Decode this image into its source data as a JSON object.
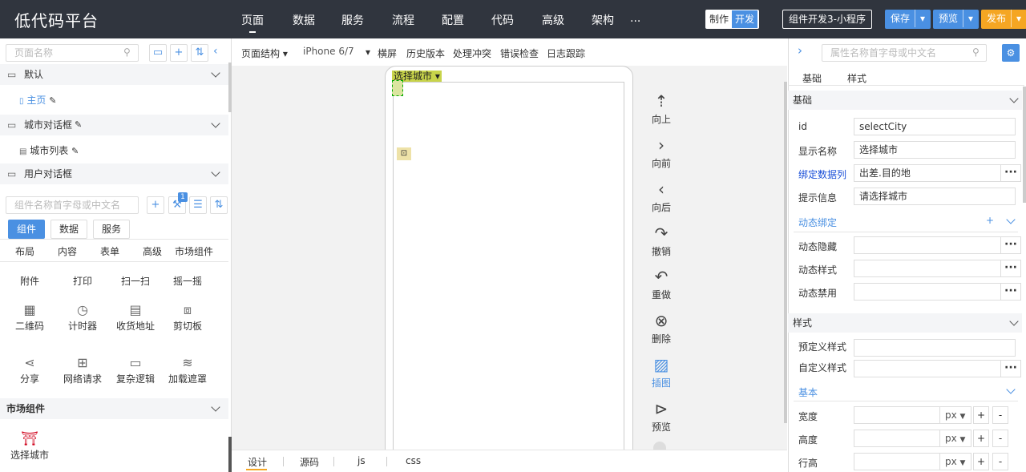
{
  "app": {
    "title": "低代码平台"
  },
  "nav": [
    "页面",
    "数据",
    "服务",
    "流程",
    "配置",
    "代码",
    "高级",
    "架构",
    "..."
  ],
  "mode": {
    "make": "制作",
    "dev": "开发"
  },
  "project": "组件开发3-小程序",
  "actions": {
    "save": "保存",
    "preview": "预览",
    "publish": "发布"
  },
  "colors": {
    "topbar": "#30353e",
    "accent": "#4a90e2",
    "publish": "#f5a623"
  },
  "left": {
    "search_placeholder": "页面名称",
    "groups": [
      {
        "label": "默认",
        "items": [
          "主页"
        ]
      },
      {
        "label": "城市对话框",
        "items": [
          "城市列表"
        ]
      },
      {
        "label": "用户对话框",
        "items": []
      }
    ],
    "comp_search_placeholder": "组件名称首字母或中文名",
    "badge": "1",
    "tabs": [
      "组件",
      "数据",
      "服务"
    ],
    "categories": [
      "布局",
      "内容",
      "表单",
      "高级",
      "市场组件"
    ],
    "partial_row": [
      "附件",
      "打印",
      "扫一扫",
      "摇一摇"
    ],
    "row1": [
      "二维码",
      "计时器",
      "收货地址",
      "剪切板"
    ],
    "row2": [
      "分享",
      "网络请求",
      "复杂逻辑",
      "加载遮罩"
    ],
    "market_title": "市场组件",
    "market_items": [
      "选择城市"
    ]
  },
  "center": {
    "toolbar": [
      "页面结构",
      "iPhone 6/7",
      "横屏",
      "历史版本",
      "处理冲突",
      "错误检查",
      "日志跟踪"
    ],
    "select_label": "选择城市",
    "side_actions": [
      "向上",
      "向前",
      "向后",
      "撤销",
      "重做",
      "删除",
      "插图",
      "预览"
    ],
    "bottom_tabs": [
      "设计",
      "源码",
      "js",
      "css"
    ]
  },
  "right": {
    "search_placeholder": "属性名称首字母或中文名",
    "tabs": [
      "基础",
      "样式"
    ],
    "basic_section": "基础",
    "props": [
      {
        "label": "id",
        "value": "selectCity"
      },
      {
        "label": "显示名称",
        "value": "选择城市"
      },
      {
        "label": "绑定数据列",
        "value": "出差.目的地"
      },
      {
        "label": "提示信息",
        "value": "请选择城市"
      }
    ],
    "dynamic_title": "动态绑定",
    "dynamic_props": [
      "动态隐藏",
      "动态样式",
      "动态禁用"
    ],
    "style_section": "样式",
    "style_props": [
      "预定义样式",
      "自定义样式"
    ],
    "base_title": "基本",
    "size_props": [
      "宽度",
      "高度",
      "行高"
    ],
    "unit": "px",
    "plus": "+",
    "minus": "-"
  }
}
